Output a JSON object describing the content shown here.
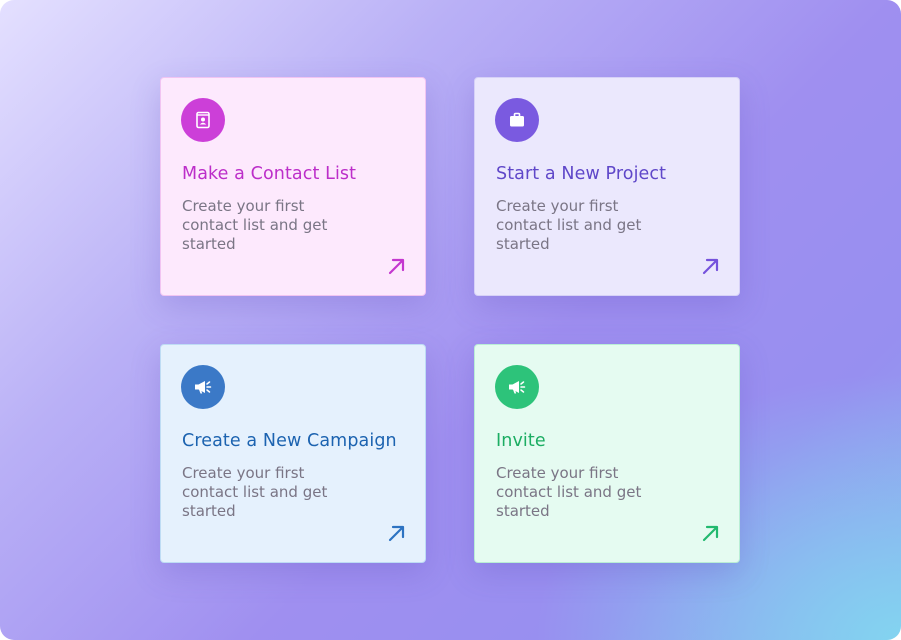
{
  "cards": [
    {
      "title": "Make a Contact List",
      "description": "Create your first contact list and get started",
      "icon": "contact-book-icon",
      "accent": "#c437cf"
    },
    {
      "title": "Start a New Project",
      "description": "Create your first contact list and get started",
      "icon": "briefcase-icon",
      "accent": "#7552dc"
    },
    {
      "title": "Create a New Campaign",
      "description": "Create your first contact list and get started",
      "icon": "megaphone-icon",
      "accent": "#2d73c2"
    },
    {
      "title": "Invite",
      "description": "Create your first contact list and get started",
      "icon": "megaphone-icon",
      "accent": "#22b96f"
    }
  ],
  "colors": {
    "contact_icon_bg": "#cc3fd8",
    "contact_title": "#bc2ec9",
    "project_icon_bg": "#7a5ae0",
    "project_title": "#5f47c9",
    "campaign_icon_bg": "#3b79c7",
    "campaign_title": "#1c63b0",
    "invite_icon_bg": "#2dc37a",
    "invite_title": "#1cad63"
  }
}
